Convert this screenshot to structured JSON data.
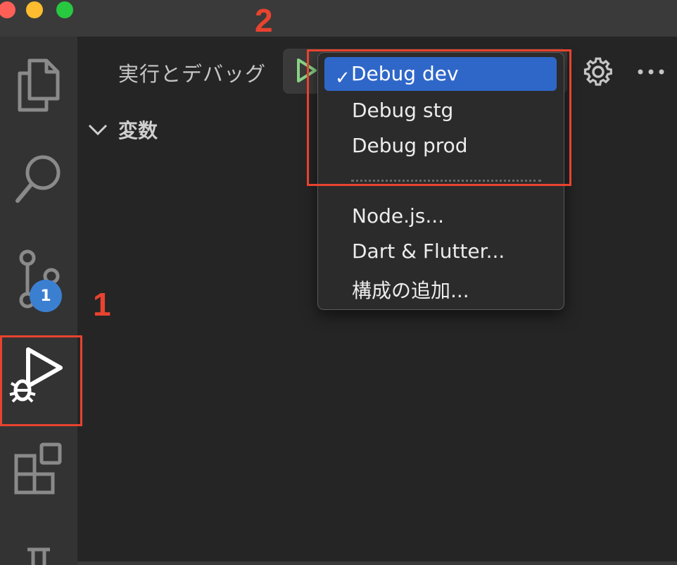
{
  "window": {
    "traffic_lights": [
      "close",
      "minimize",
      "zoom"
    ]
  },
  "activity_bar": {
    "items": [
      {
        "name": "explorer",
        "icon": "files-icon"
      },
      {
        "name": "search",
        "icon": "search-icon"
      },
      {
        "name": "source-control",
        "icon": "source-control-icon",
        "badge": "1"
      },
      {
        "name": "run-and-debug",
        "icon": "run-debug-icon",
        "active": true
      },
      {
        "name": "extensions",
        "icon": "extensions-icon"
      },
      {
        "name": "testing",
        "icon": "testing-icon"
      }
    ]
  },
  "sidebar": {
    "title": "実行とデバッグ",
    "sections": [
      {
        "label": "変数"
      }
    ]
  },
  "dropdown": {
    "items": [
      {
        "label": "Debug dev",
        "selected": true,
        "check": "✓"
      },
      {
        "label": "Debug stg"
      },
      {
        "label": "Debug prod"
      },
      {
        "label": "Node.js..."
      },
      {
        "label": "Dart & Flutter..."
      },
      {
        "label": "構成の追加..."
      }
    ]
  },
  "annotations": {
    "label_1": "1",
    "label_2": "2"
  },
  "colors": {
    "annotation": "#e8432f",
    "selection": "#2f67c9",
    "badge": "#3b7fd1",
    "play": "#89d185"
  }
}
